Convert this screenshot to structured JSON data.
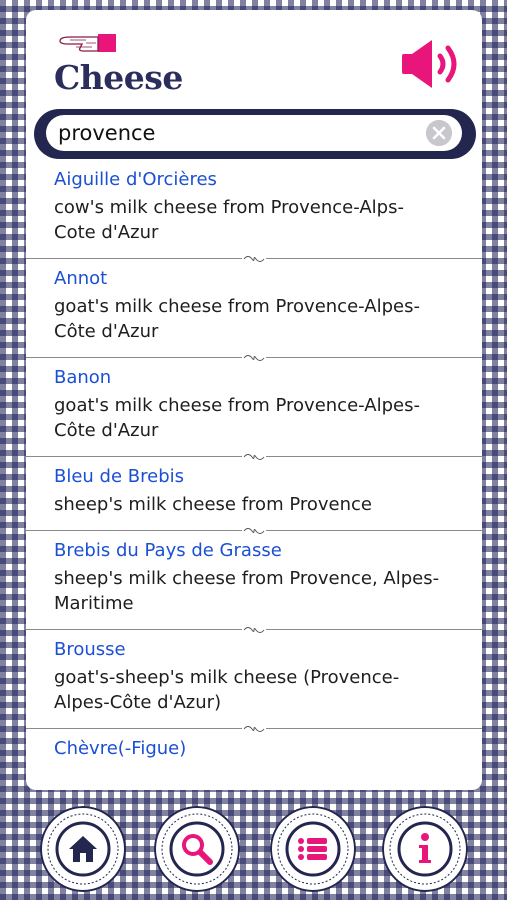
{
  "header": {
    "title": "Cheese"
  },
  "search": {
    "value": "provence",
    "placeholder": ""
  },
  "results": [
    {
      "name": "Aiguille d'Orcières",
      "desc": "cow's milk cheese from Provence-Alps-Cote d'Azur"
    },
    {
      "name": "Annot",
      "desc": "goat's milk cheese from Provence-Alpes-Côte d'Azur"
    },
    {
      "name": "Banon",
      "desc": "goat's milk cheese from  Provence-Alpes-Côte d'Azur"
    },
    {
      "name": "Bleu de Brebis",
      "desc": "sheep's milk cheese from Provence"
    },
    {
      "name": "Brebis du Pays de Grasse",
      "desc": "sheep's milk cheese from Provence, Alpes-Maritime"
    },
    {
      "name": "Brousse",
      "desc": "goat's-sheep's milk cheese (Provence-Alpes-Côte d'Azur)"
    },
    {
      "name": "Chèvre(-Figue)",
      "desc": ""
    }
  ],
  "icons": {
    "hand": "pointing-hand-icon",
    "speaker": "speaker-icon",
    "clear": "clear-icon",
    "home": "home-icon",
    "search": "search-icon",
    "list": "list-icon",
    "info": "info-icon"
  },
  "colors": {
    "accent": "#e8157a",
    "navy": "#23264f",
    "link": "#1b4fd4"
  }
}
